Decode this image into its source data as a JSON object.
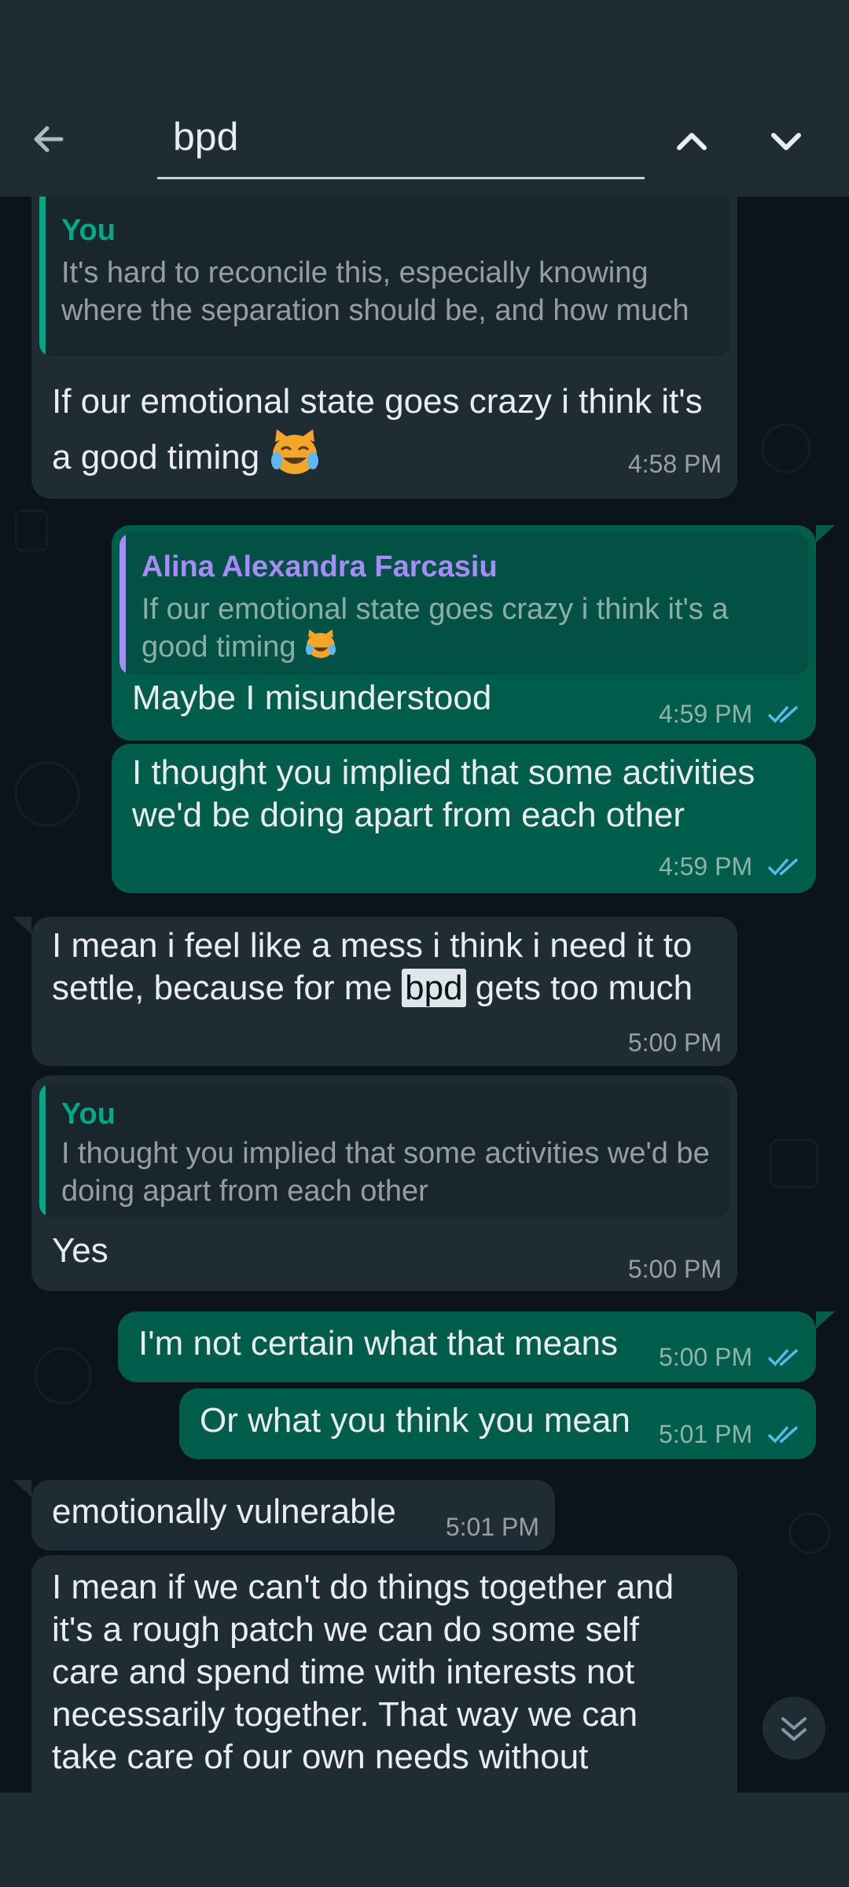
{
  "search": {
    "query": "bpd",
    "back_icon": "arrow-left-icon",
    "prev_icon": "chevron-up-icon",
    "next_icon": "chevron-down-icon"
  },
  "messages": [
    {
      "direction": "incoming",
      "quote": {
        "name": "You",
        "text": "It's hard to reconcile this, especially knowing where the separation should be, and how much"
      },
      "text": "If our emotional state goes crazy i think it's a good timing",
      "emoji": "cat-tears-of-joy-emoji",
      "time": "4:58 PM"
    },
    {
      "direction": "outgoing",
      "quote": {
        "name": "Alina Alexandra Farcasiu",
        "text": "If our emotional state goes crazy i think it's a good timing"
      },
      "text": "Maybe I misunderstood",
      "time": "4:59 PM",
      "status": "read"
    },
    {
      "direction": "outgoing",
      "text": "I thought you implied that some activities we'd be doing apart from each other",
      "time": "4:59 PM",
      "status": "read"
    },
    {
      "direction": "incoming",
      "text_before": "I mean i feel like a mess i think i need it to settle, because for me ",
      "highlight": "bpd",
      "text_after": " gets too much",
      "time": "5:00 PM"
    },
    {
      "direction": "incoming",
      "quote": {
        "name": "You",
        "text": "I thought you implied that some activities we'd be doing apart from each other"
      },
      "text": "Yes",
      "time": "5:00 PM"
    },
    {
      "direction": "outgoing",
      "text": "I'm not certain what that means",
      "time": "5:00 PM",
      "status": "read"
    },
    {
      "direction": "outgoing",
      "text": "Or what you think you mean",
      "time": "5:01 PM",
      "status": "read"
    },
    {
      "direction": "incoming",
      "text": "emotionally vulnerable",
      "time": "5:01 PM"
    },
    {
      "direction": "incoming",
      "text": "I mean if we can't do things together and it's a rough patch we can do some self care and spend time with interests not necessarily together. That way we can take care of our own needs without"
    }
  ],
  "scroll_button_icon": "double-chevron-down-icon",
  "colors": {
    "header_bg": "#1f2c34",
    "chat_bg": "#0b141a",
    "incoming_bubble": "#202c33",
    "outgoing_bubble": "#005c4b",
    "quote_you": "#00a884",
    "quote_alina": "#a78bfa",
    "read_ticks": "#53bdeb"
  }
}
